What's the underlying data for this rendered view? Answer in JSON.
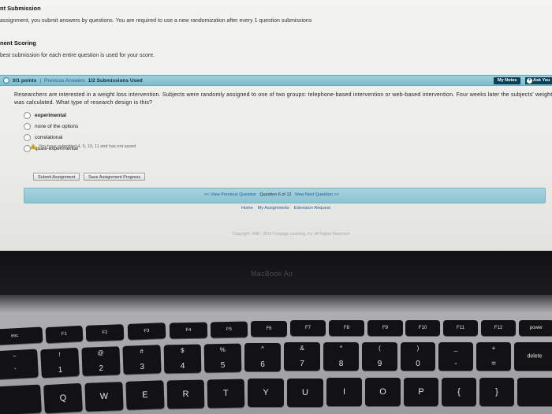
{
  "intro": {
    "title": "nt Submission",
    "text1": "assignment, you submit answers by questions. You are required to use a new randomization after every 1 question submissions",
    "scoring_title": "nent Scoring",
    "text2": "best submission for each entire question is used for your score."
  },
  "question_header": {
    "points": "0/1 points",
    "separator": "|",
    "previous_answers": "Previous Answers",
    "submissions": "1/2 Submissions Used",
    "my_notes": "My Notes",
    "ask": "Ask You"
  },
  "question": {
    "text": "Researchers are interested in a weight loss intervention. Subjects were randomly assigned to one of two groups: telephone-based intervention or web-based intervention. Four weeks later the subjects' weight was calculated. What type of research design is this?",
    "options": [
      {
        "label": "experimental"
      },
      {
        "label": "none of the options"
      },
      {
        "label": "correlational"
      },
      {
        "label": "quasi-experimental"
      }
    ]
  },
  "warning": "You have submitted 4, 5, 10, 11 and has not saved",
  "buttons": {
    "submit": "Submit Assignment",
    "save": "Save Assignment Progress"
  },
  "nav": {
    "prev": "<< View Previous Question",
    "question_of": "Question 6 of 12",
    "next": "View Next Question >>"
  },
  "bottom_links": {
    "home": "Home",
    "my_assignments": "My Assignments",
    "extension": "Extension Request"
  },
  "footer_text": "Copyright 1998 - 2019 Cengage Learning, Inc. All Rights Reserved",
  "laptop_brand": "MacBook Air",
  "keyboard": {
    "function_row": [
      "esc",
      "F1",
      "F2",
      "F3",
      "F4",
      "F5",
      "F6",
      "F7",
      "F8",
      "F9",
      "F10",
      "F11",
      "F12",
      "power"
    ],
    "number_row": [
      {
        "top": "~",
        "bottom": "`"
      },
      {
        "top": "!",
        "bottom": "1"
      },
      {
        "top": "@",
        "bottom": "2"
      },
      {
        "top": "#",
        "bottom": "3"
      },
      {
        "top": "$",
        "bottom": "4"
      },
      {
        "top": "%",
        "bottom": "5"
      },
      {
        "top": "^",
        "bottom": "6"
      },
      {
        "top": "&",
        "bottom": "7"
      },
      {
        "top": "*",
        "bottom": "8"
      },
      {
        "top": "(",
        "bottom": "9"
      },
      {
        "top": ")",
        "bottom": "0"
      },
      {
        "top": "_",
        "bottom": "-"
      },
      {
        "top": "+",
        "bottom": "="
      },
      {
        "top": "",
        "bottom": "delete"
      }
    ],
    "letter_row": [
      "Q",
      "W",
      "E",
      "R",
      "T",
      "Y",
      "U",
      "I",
      "O",
      "P",
      "{",
      "}"
    ]
  }
}
